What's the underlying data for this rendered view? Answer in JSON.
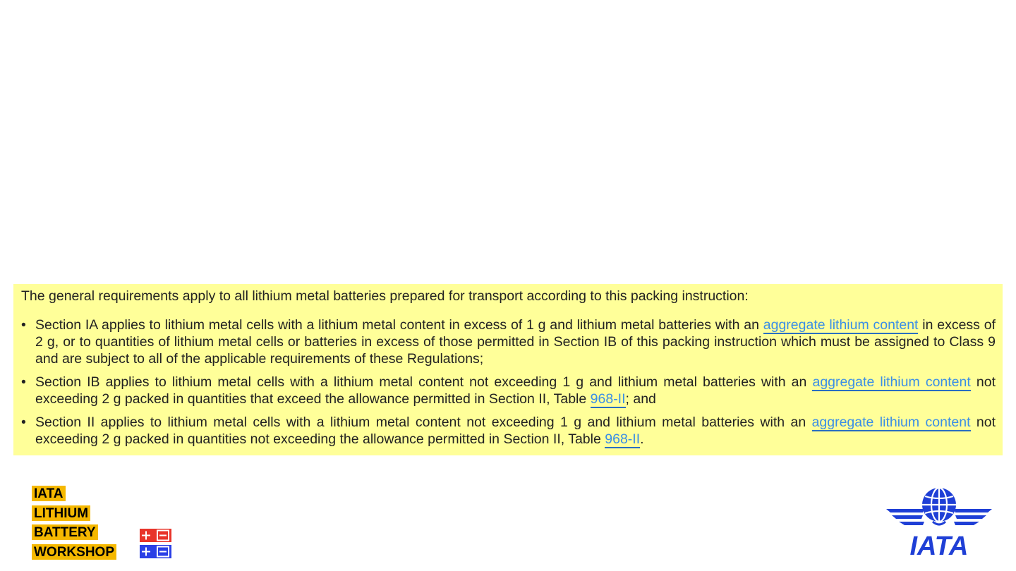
{
  "content": {
    "intro": "The general requirements apply to all lithium metal batteries prepared for transport according to this packing instruction:",
    "bullets": [
      {
        "before": "Section IA applies to lithium metal cells with a lithium metal content in excess of 1 g and lithium metal batteries with an ",
        "link": "aggregate lithium content",
        "after": " in excess of 2 g, or to quantities of lithium metal cells or batteries in excess of those permitted in Section IB of this packing instruction which must be assigned to Class 9 and are subject to all of the applicable requirements of these Regulations;"
      },
      {
        "before": "Section IB applies to lithium metal cells with a lithium metal content not exceeding 1 g and lithium metal batteries with an ",
        "link": "aggregate lithium content",
        "middle": " not exceeding 2 g packed in quantities that exceed the allowance permitted in Section II, Table ",
        "table_link": "968-II",
        "after": "; and"
      },
      {
        "before": "Section II applies to lithium metal cells with a lithium metal content not exceeding 1 g and lithium metal batteries with an ",
        "link": "aggregate lithium content",
        "middle": " not exceeding 2 g packed in quantities not exceeding the allowance permitted in Section II, Table ",
        "table_link": "968-II",
        "after": "."
      }
    ]
  },
  "workshop_logo": {
    "lines": [
      "IATA",
      "LITHIUM",
      "BATTERY",
      "WORKSHOP"
    ],
    "plus": "+",
    "minus": "−"
  },
  "iata_logo": {
    "text": "IATA"
  },
  "colors": {
    "highlight": "#ffff99",
    "link": "#3a8ee6",
    "workshop_label": "#f5b800",
    "battery_red": "#e8342a",
    "battery_blue": "#2a3fe6",
    "iata_blue": "#1f3fd6"
  }
}
